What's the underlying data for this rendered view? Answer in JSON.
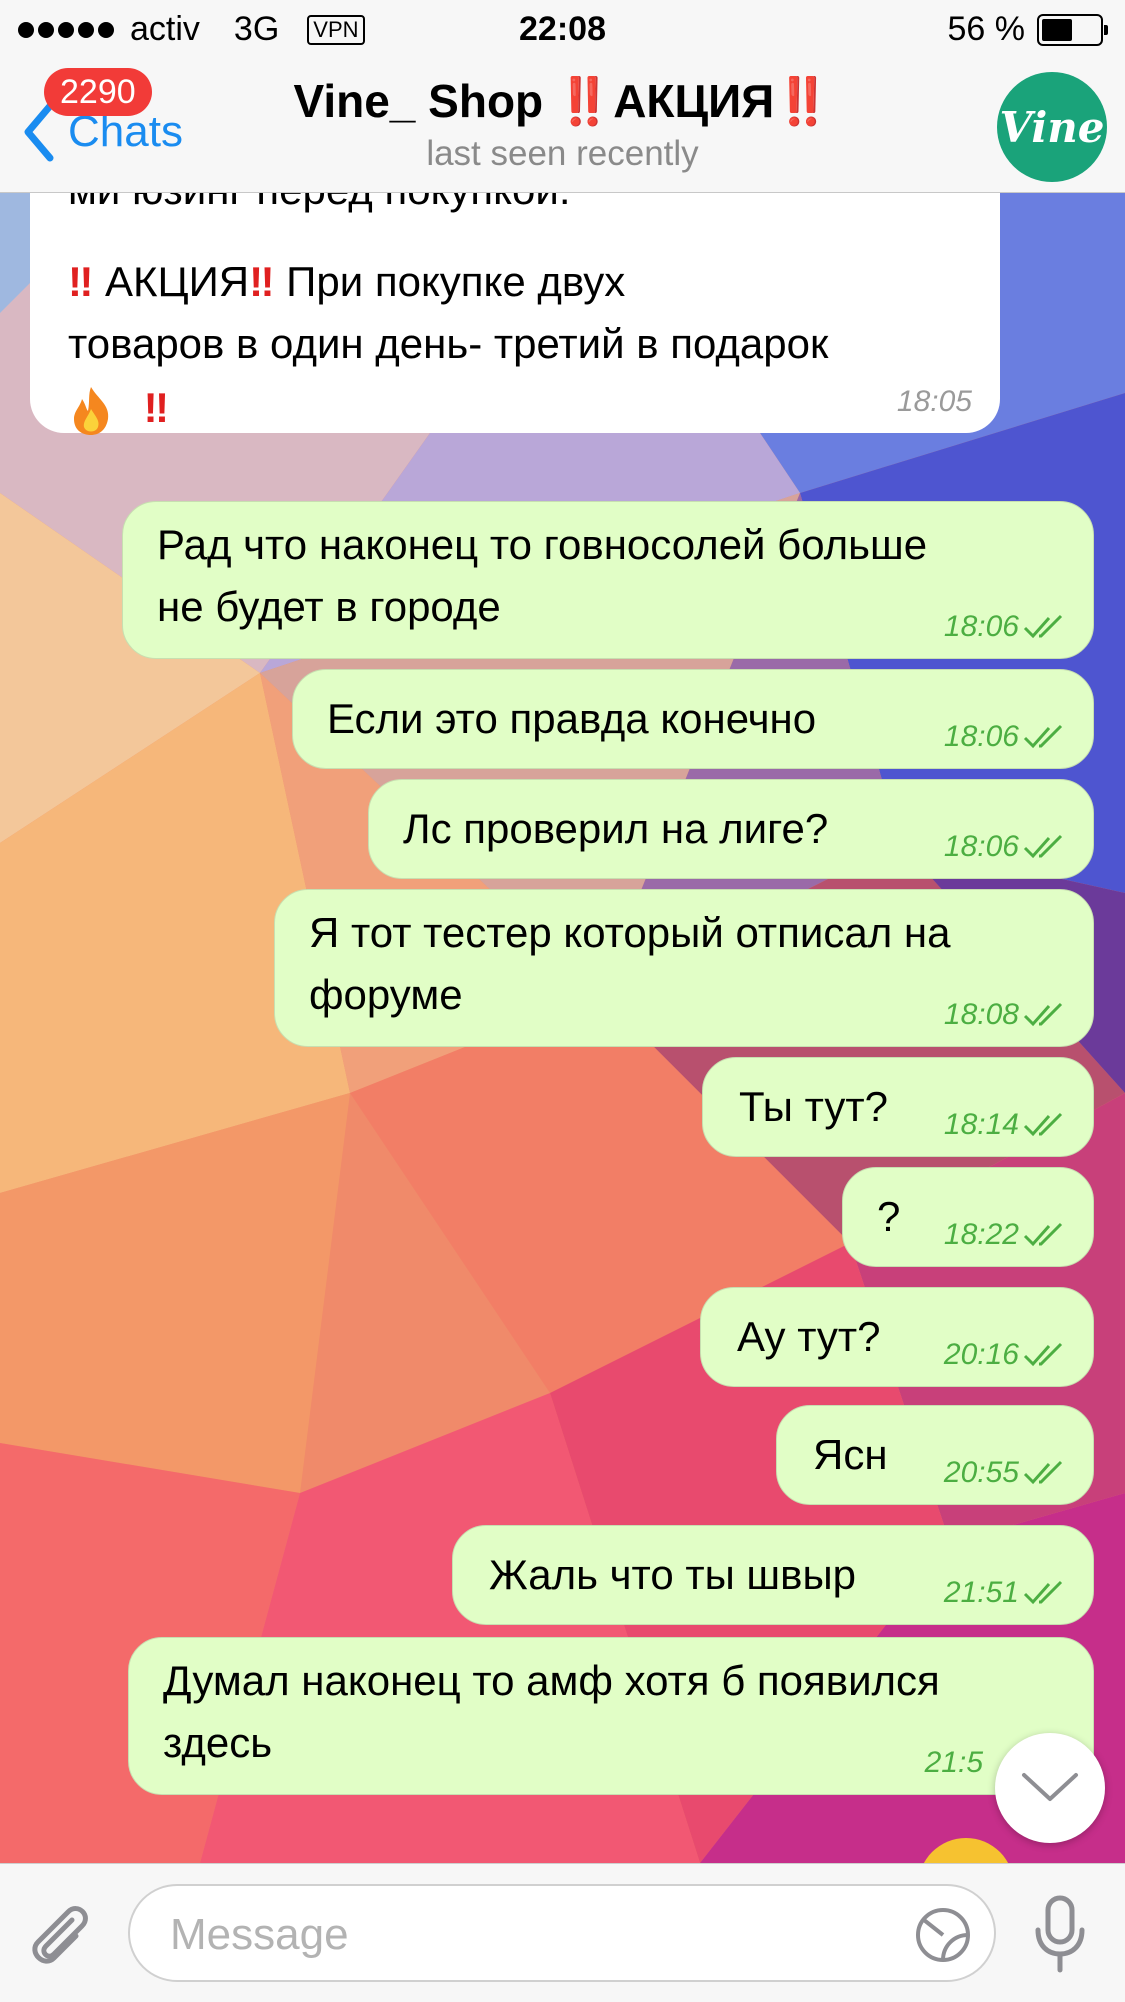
{
  "status_bar": {
    "carrier": "activ",
    "network": "3G",
    "vpn": "VPN",
    "time": "22:08",
    "battery": "56 %",
    "battery_level": 0.56
  },
  "nav": {
    "back_label": "Chats",
    "unread_badge": "2290",
    "title_name": "Vine_ Shop ",
    "title_mark": "‼️",
    "title_word": "АКЦИЯ",
    "subtitle": "last seen recently",
    "avatar_text": "Vine"
  },
  "messages": [
    {
      "dir": "in",
      "text_top": "ми юзинг перед покупкой.",
      "line1_a": "‼",
      "line1_b": " АКЦИЯ",
      "line1_c": "‼",
      "line1_d": "  При покупке двух",
      "line2": "товаров в один день- третий в подарок",
      "line3_mark": "‼",
      "time": "18:05"
    },
    {
      "dir": "out",
      "text": "Рад что наконец то говносолей больше\nне будет в городе",
      "time": "18:06"
    },
    {
      "dir": "out",
      "text": "Если это правда конечно",
      "time": "18:06"
    },
    {
      "dir": "out",
      "text": "Лс проверил на лиге?",
      "time": "18:06"
    },
    {
      "dir": "out",
      "text": "Я тот тестер который отписал на\nфоруме",
      "time": "18:08"
    },
    {
      "dir": "out",
      "text": "Ты тут?",
      "time": "18:14"
    },
    {
      "dir": "out",
      "text": "?",
      "time": "18:22"
    },
    {
      "dir": "out",
      "text": "Ау тут?",
      "time": "20:16"
    },
    {
      "dir": "out",
      "text": "Ясн",
      "time": "20:55"
    },
    {
      "dir": "out",
      "text": "Жаль что ты швыр",
      "time": "21:51"
    },
    {
      "dir": "out",
      "text": "Думал наконец то амф хотя б появился\nздесь",
      "time": "21:5"
    }
  ],
  "input": {
    "placeholder": "Message"
  },
  "colors": {
    "accent": "#1a8cf0",
    "badge": "#f23b38",
    "outgoing_bubble": "#e1fec6",
    "read_tick": "#4cae42",
    "avatar_bg": "#1aa37a"
  },
  "icons": [
    "chevron-left-icon",
    "attach-icon",
    "sticker-icon",
    "mic-icon",
    "chevron-down-icon",
    "double-check-icon",
    "fire-icon"
  ]
}
